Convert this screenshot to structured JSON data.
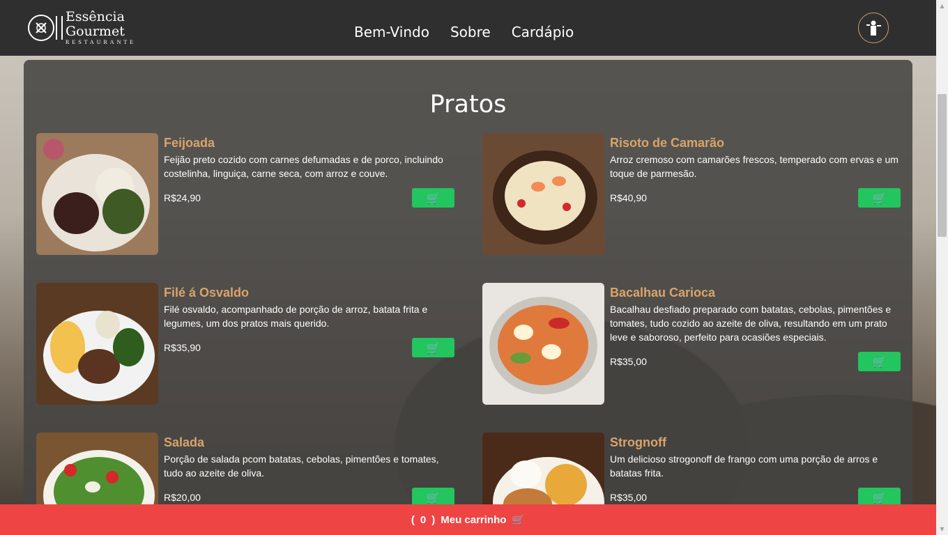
{
  "brand": {
    "line1": "Essência",
    "line2": "Gourmet",
    "sub": "RESTAURANTE"
  },
  "nav": {
    "items": [
      {
        "label": "Bem-Vindo"
      },
      {
        "label": "Sobre"
      },
      {
        "label": "Cardápio"
      }
    ]
  },
  "section": {
    "title": "Pratos"
  },
  "dishes": [
    {
      "name": "Feijoada",
      "desc": "Feijão preto cozido com carnes defumadas e de porco, incluindo costelinha, linguiça, carne seca, com arroz e couve.",
      "price": "R$24,90"
    },
    {
      "name": "Risoto de Camarão",
      "desc": "Arroz cremoso com camarões frescos, temperado com ervas e um toque de parmesão.",
      "price": "R$40,90"
    },
    {
      "name": "Filé á Osvaldo",
      "desc": "Filé osvaldo, acompanhado de porção de arroz, batata frita e legumes, um dos pratos mais querido.",
      "price": "R$35,90"
    },
    {
      "name": "Bacalhau Carioca",
      "desc": "Bacalhau desfiado preparado com batatas, cebolas, pimentões e tomates, tudo cozido ao azeite de oliva, resultando em um prato leve e saboroso, perfeito para ocasiões especiais.",
      "price": "R$35,00"
    },
    {
      "name": "Salada",
      "desc": "Porção de salada pcom batatas, cebolas, pimentões e tomates, tudo ao azeite de oliva.",
      "price": "R$20,00"
    },
    {
      "name": "Strognoff",
      "desc": "Um delicioso strogonoff de frango com uma porção de arros e batatas frita.",
      "price": "R$35,00"
    }
  ],
  "cart": {
    "open": "(",
    "count": "0",
    "close": ")",
    "label": "Meu carrinho"
  },
  "icons": {
    "cart": "cart-plus-icon",
    "waiter": "waiter-icon",
    "logo": "fork-knife-icon"
  },
  "colors": {
    "header": "#2f2f2f",
    "accent_name": "#d9a46a",
    "cart_button": "#22c55e",
    "cart_bar": "#ef4444"
  }
}
